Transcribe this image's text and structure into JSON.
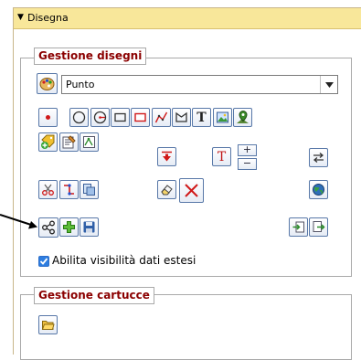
{
  "panel": {
    "title": "Disegna"
  },
  "drawings": {
    "legend": "Gestione disegni",
    "select_value": "Punto",
    "stack_plus": "+",
    "stack_minus": "−",
    "checkbox_label": "Abilita visibilità dati estesi",
    "checkbox_checked": true,
    "text_glyph": "T"
  },
  "cartridges": {
    "legend": "Gestione cartucce"
  },
  "colors": {
    "header_bg": "#f8e79a",
    "legend_text": "#8b0000",
    "button_border": "#5878a8"
  }
}
